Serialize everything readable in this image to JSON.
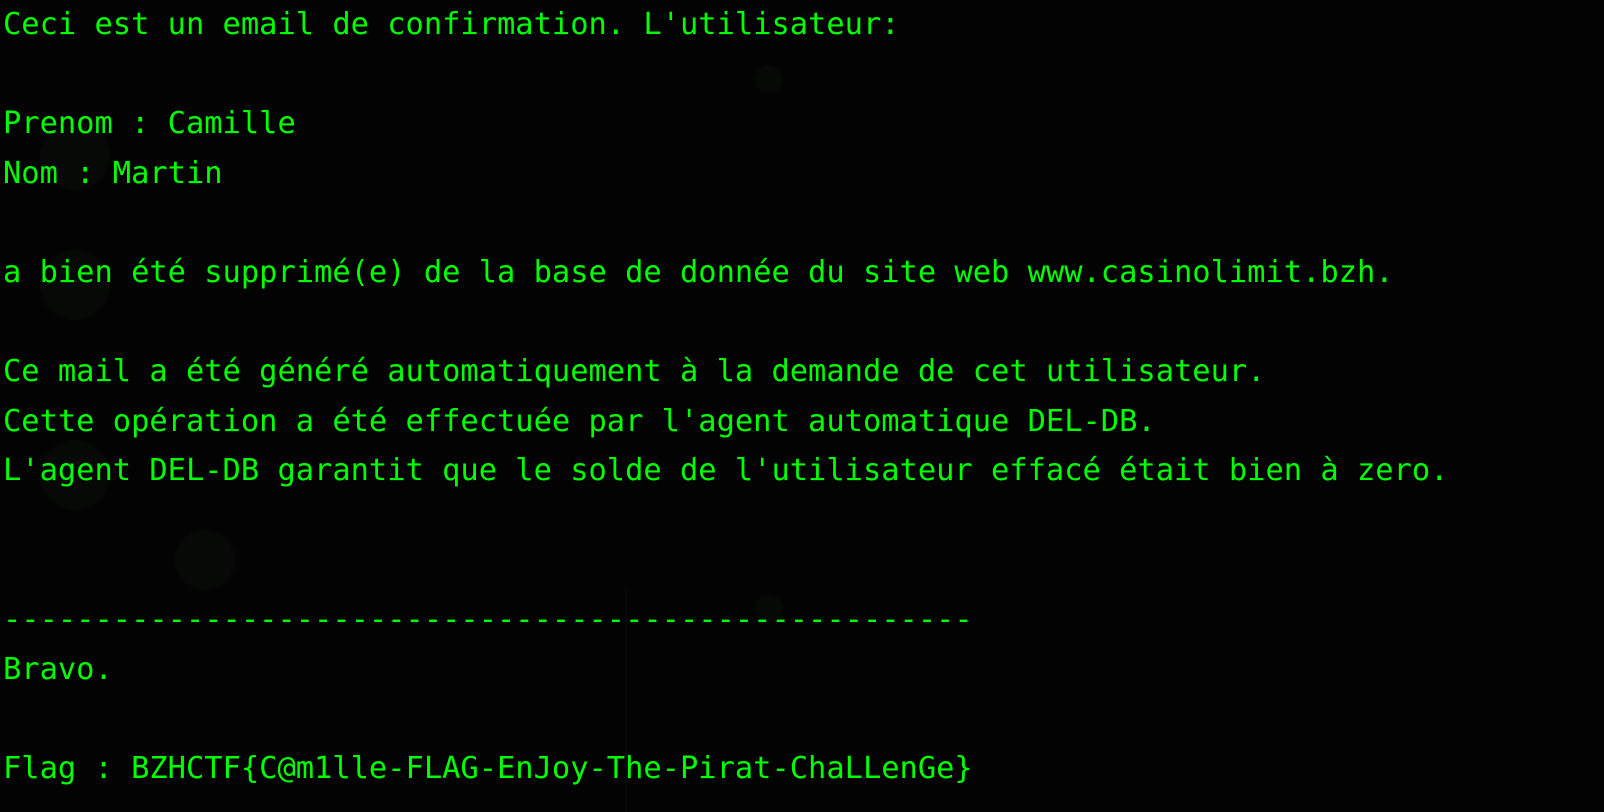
{
  "colors": {
    "background": "#020302",
    "text": "#00ff00"
  },
  "terminal": {
    "lines": [
      "Ceci est un email de confirmation. L'utilisateur:",
      "",
      "Prenom : Camille",
      "Nom : Martin",
      "",
      "a bien été supprimé(e) de la base de donnée du site web www.casinolimit.bzh.",
      "",
      "Ce mail a été généré automatiquement à la demande de cet utilisateur.",
      "Cette opération a été effectuée par l'agent automatique DEL-DB.",
      "L'agent DEL-DB garantit que le solde de l'utilisateur effacé était bien à zero.",
      "",
      "",
      "-----------------------------------------------------",
      "Bravo.",
      "",
      "Flag : BZHCTF{C@m1lle-FLAG-EnJoy-The-Pirat-ChaLLenGe}"
    ]
  }
}
